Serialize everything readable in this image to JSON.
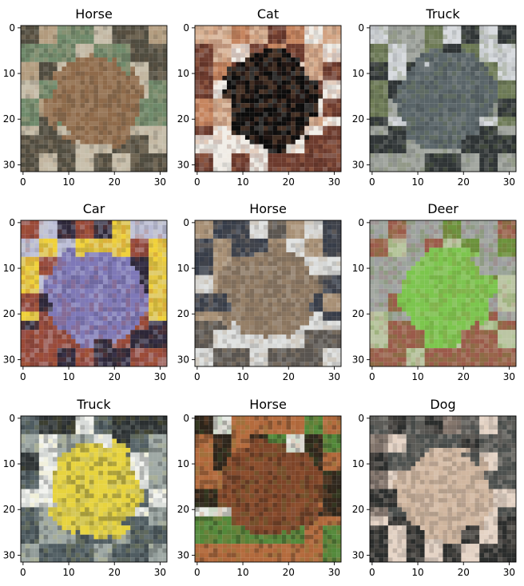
{
  "figure": {
    "panels": [
      {
        "title": "Horse",
        "x_ticks": [
          "0",
          "10",
          "20",
          "30"
        ],
        "y_ticks": [
          "0",
          "10",
          "20",
          "30"
        ],
        "palette": [
          "#6f8a6b",
          "#8f6a4a",
          "#c9c0ad",
          "#4f4b3f",
          "#b59f82"
        ]
      },
      {
        "title": "Cat",
        "x_ticks": [
          "0",
          "10",
          "20",
          "30"
        ],
        "y_ticks": [
          "0",
          "10",
          "20",
          "30"
        ],
        "palette": [
          "#d7b092",
          "#0b0b0b",
          "#f1eee8",
          "#6c3a2d",
          "#c6855f"
        ]
      },
      {
        "title": "Truck",
        "x_ticks": [
          "0",
          "10",
          "20",
          "30"
        ],
        "y_ticks": [
          "0",
          "10",
          "20",
          "30"
        ],
        "palette": [
          "#d8dbdf",
          "#596468",
          "#2d3233",
          "#a3a7a0",
          "#6e7b55"
        ]
      },
      {
        "title": "Car",
        "x_ticks": [
          "0",
          "10",
          "20",
          "30"
        ],
        "y_ticks": [
          "0",
          "10",
          "20",
          "30"
        ],
        "palette": [
          "#f0d13a",
          "#7e78b8",
          "#2d2738",
          "#9a4a38",
          "#c1c4d9"
        ]
      },
      {
        "title": "Horse",
        "x_ticks": [
          "0",
          "10",
          "20",
          "30"
        ],
        "y_ticks": [
          "0",
          "10",
          "20",
          "30"
        ],
        "palette": [
          "#373d49",
          "#8b7660",
          "#e0e2e1",
          "#5a5550",
          "#aa9277"
        ]
      },
      {
        "title": "Deer",
        "x_ticks": [
          "0",
          "10",
          "20",
          "30"
        ],
        "y_ticks": [
          "0",
          "10",
          "20",
          "30"
        ],
        "palette": [
          "#9ea0a2",
          "#7cc64d",
          "#9b5a4a",
          "#bcc6a4",
          "#6b8f3b"
        ]
      },
      {
        "title": "Truck",
        "x_ticks": [
          "0",
          "10",
          "20",
          "30"
        ],
        "y_ticks": [
          "0",
          "10",
          "20",
          "30"
        ],
        "palette": [
          "#f2f3ef",
          "#e7d33e",
          "#4f5c61",
          "#9fa9a5",
          "#2a2f30"
        ]
      },
      {
        "title": "Horse",
        "x_ticks": [
          "0",
          "10",
          "20",
          "30"
        ],
        "y_ticks": [
          "0",
          "10",
          "20",
          "30"
        ],
        "palette": [
          "#e8ece7",
          "#7d4428",
          "#53893a",
          "#b46b3d",
          "#2c241a"
        ]
      },
      {
        "title": "Dog",
        "x_ticks": [
          "0",
          "10",
          "20",
          "30"
        ],
        "y_ticks": [
          "0",
          "10",
          "20",
          "30"
        ],
        "palette": [
          "#4d514f",
          "#d1b7a0",
          "#2b2d2c",
          "#e7d6c8",
          "#7d7068"
        ]
      }
    ]
  }
}
